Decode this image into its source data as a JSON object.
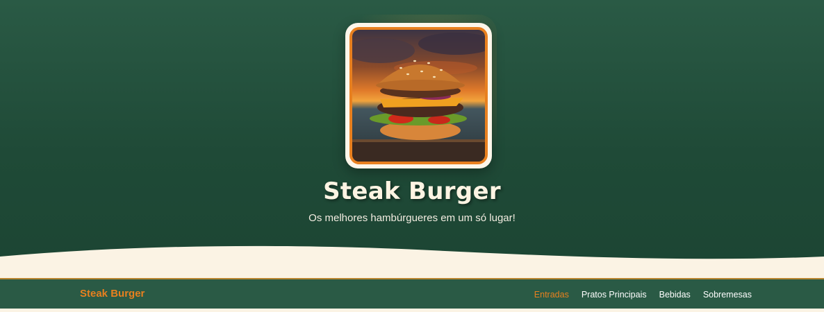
{
  "hero": {
    "logo_alt": "Steak Burger logo",
    "title": "Steak Burger",
    "subtitle": "Os melhores hambúrgueres em um só lugar!"
  },
  "navbar": {
    "brand": "Steak Burger",
    "links": [
      {
        "label": "Entradas",
        "active": true
      },
      {
        "label": "Pratos Principais",
        "active": false
      },
      {
        "label": "Bebidas",
        "active": false
      },
      {
        "label": "Sobremesas",
        "active": false
      }
    ]
  },
  "colors": {
    "hero_green": "#2a5a45",
    "accent_orange": "#e8801f",
    "cream": "#fbf3e4",
    "nav_border": "#b9852f"
  }
}
